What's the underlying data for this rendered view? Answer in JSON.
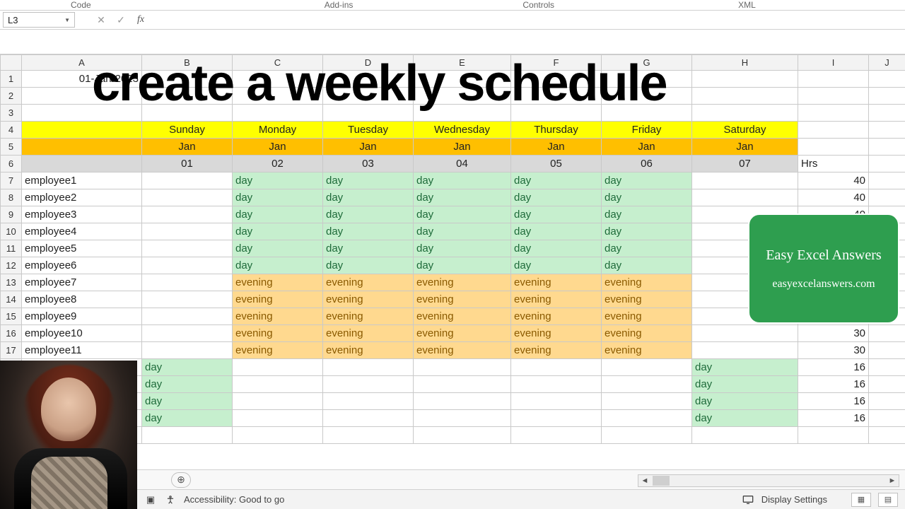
{
  "ribbonLabels": {
    "l1": "Code",
    "l2": "Add-ins",
    "l3": "Controls",
    "l4": "XML"
  },
  "nameBox": {
    "value": "L3"
  },
  "formulaBar": {
    "value": ""
  },
  "overlayTitle": "create a weekly schedule",
  "promo": {
    "line1": "Easy Excel Answers",
    "line2": "easyexcelanswers.com"
  },
  "status": {
    "accessibilityLabel": "Accessibility: Good to go",
    "displaySettings": "Display Settings"
  },
  "columns": [
    "A",
    "B",
    "C",
    "D",
    "E",
    "F",
    "G",
    "H",
    "I",
    "J"
  ],
  "cells": {
    "A1": "01-Jan-2023",
    "I6": "Hrs"
  },
  "headerDays": {
    "B4": "Sunday",
    "C4": "Monday",
    "D4": "Tuesday",
    "E4": "Wednesday",
    "F4": "Thursday",
    "G4": "Friday",
    "H4": "Saturday"
  },
  "headerMonths": {
    "B5": "Jan",
    "C5": "Jan",
    "D5": "Jan",
    "E5": "Jan",
    "F5": "Jan",
    "G5": "Jan",
    "H5": "Jan"
  },
  "headerNums": {
    "B6": "01",
    "C6": "02",
    "D6": "03",
    "E6": "04",
    "F6": "05",
    "G6": "06",
    "H6": "07"
  },
  "employees": [
    {
      "row": 7,
      "name": "employee1",
      "sun": "",
      "mon": "day",
      "tue": "day",
      "wed": "day",
      "thu": "day",
      "fri": "day",
      "sat": "",
      "hrs": "40"
    },
    {
      "row": 8,
      "name": "employee2",
      "sun": "",
      "mon": "day",
      "tue": "day",
      "wed": "day",
      "thu": "day",
      "fri": "day",
      "sat": "",
      "hrs": "40"
    },
    {
      "row": 9,
      "name": "employee3",
      "sun": "",
      "mon": "day",
      "tue": "day",
      "wed": "day",
      "thu": "day",
      "fri": "day",
      "sat": "",
      "hrs": "40"
    },
    {
      "row": 10,
      "name": "employee4",
      "sun": "",
      "mon": "day",
      "tue": "day",
      "wed": "day",
      "thu": "day",
      "fri": "day",
      "sat": "",
      "hrs": ""
    },
    {
      "row": 11,
      "name": "employee5",
      "sun": "",
      "mon": "day",
      "tue": "day",
      "wed": "day",
      "thu": "day",
      "fri": "day",
      "sat": "",
      "hrs": ""
    },
    {
      "row": 12,
      "name": "employee6",
      "sun": "",
      "mon": "day",
      "tue": "day",
      "wed": "day",
      "thu": "day",
      "fri": "day",
      "sat": "",
      "hrs": ""
    },
    {
      "row": 13,
      "name": "employee7",
      "sun": "",
      "mon": "evening",
      "tue": "evening",
      "wed": "evening",
      "thu": "evening",
      "fri": "evening",
      "sat": "",
      "hrs": ""
    },
    {
      "row": 14,
      "name": "employee8",
      "sun": "",
      "mon": "evening",
      "tue": "evening",
      "wed": "evening",
      "thu": "evening",
      "fri": "evening",
      "sat": "",
      "hrs": ""
    },
    {
      "row": 15,
      "name": "employee9",
      "sun": "",
      "mon": "evening",
      "tue": "evening",
      "wed": "evening",
      "thu": "evening",
      "fri": "evening",
      "sat": "",
      "hrs": ""
    },
    {
      "row": 16,
      "name": "employee10",
      "sun": "",
      "mon": "evening",
      "tue": "evening",
      "wed": "evening",
      "thu": "evening",
      "fri": "evening",
      "sat": "",
      "hrs": "30"
    },
    {
      "row": 17,
      "name": "employee11",
      "sun": "",
      "mon": "evening",
      "tue": "evening",
      "wed": "evening",
      "thu": "evening",
      "fri": "evening",
      "sat": "",
      "hrs": "30"
    }
  ],
  "weekendRows": [
    {
      "sun": "day",
      "sat": "day",
      "hrs": "16"
    },
    {
      "sun": "day",
      "sat": "day",
      "hrs": "16"
    },
    {
      "sun": "day",
      "sat": "day",
      "hrs": "16"
    },
    {
      "sun": "day",
      "sat": "day",
      "hrs": "16"
    }
  ]
}
